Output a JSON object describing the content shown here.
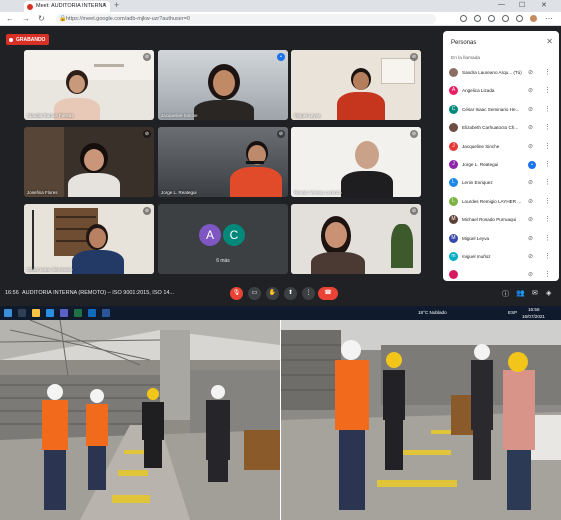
{
  "browser": {
    "tab_title": "Meet: AUDITORIA INTERNA",
    "url": "https://meet.google.com/adb-mjkw-uzr?authuser=0",
    "new_tab": "+",
    "minimize": "—",
    "maximize": "☐",
    "close": "✕"
  },
  "meet": {
    "recording_label": "GRABANDO",
    "time": "16:56",
    "meeting_title": "AUDITORIA INTERNA (REMOTO) – ISO 9001:2015, ISO 14...",
    "tiles": [
      {
        "label": "Claudia Ramos Fiestas",
        "mic": "muted"
      },
      {
        "label": "Jacqueline Sinche",
        "mic": "active"
      },
      {
        "label": "Miguel Leyva",
        "mic": "muted"
      },
      {
        "label": "Josefina Flores",
        "mic": "muted"
      },
      {
        "label": "Jorge L. Reategui",
        "mic": "muted"
      },
      {
        "label": "Renato Vereau Lorenzo",
        "mic": "muted"
      },
      {
        "label": "César Isaac Seminario",
        "mic": "muted"
      },
      {
        "label": "",
        "mic": ""
      },
      {
        "label": "",
        "mic": "muted"
      }
    ],
    "others": {
      "avatars": [
        "A",
        "C"
      ],
      "count_label": "6 más"
    }
  },
  "people_panel": {
    "title": "Personas",
    "close_icon": "✕",
    "section_label": "En la llamada",
    "participants": [
      {
        "name": "Sandra Laureano Arqu... (Tú)",
        "initial": "",
        "color": "#8d6e63",
        "mic": "muted"
      },
      {
        "name": "Angelica Lizada",
        "initial": "A",
        "color": "#e91e63",
        "mic": "muted"
      },
      {
        "name": "César Isaac Seminario He...",
        "initial": "C",
        "color": "#00897b",
        "mic": "muted"
      },
      {
        "name": "Elizabeth Carhuatocto Ch...",
        "initial": "",
        "color": "#6d4c41",
        "mic": "muted"
      },
      {
        "name": "Jacqueline Sinche",
        "initial": "J",
        "color": "#e53935",
        "mic": "muted"
      },
      {
        "name": "Jorge L. Reategui",
        "initial": "J",
        "color": "#8e24aa",
        "mic": "active"
      },
      {
        "name": "Lenin Enriquez",
        "initial": "L",
        "color": "#1e88e5",
        "mic": "muted"
      },
      {
        "name": "Lourdes Remigio LAYHER ...",
        "initial": "L",
        "color": "#7cb342",
        "mic": "muted"
      },
      {
        "name": "Michael Rosado Purruaqui",
        "initial": "M",
        "color": "#5d4037",
        "mic": "muted"
      },
      {
        "name": "Miguel Leyva",
        "initial": "M",
        "color": "#3949ab",
        "mic": "muted"
      },
      {
        "name": "miguel muñoz",
        "initial": "m",
        "color": "#00acc1",
        "mic": "muted"
      },
      {
        "name": "",
        "initial": "",
        "color": "#d81b60",
        "mic": "muted"
      }
    ]
  },
  "taskbar": {
    "weather": "18°C Nublado",
    "lang": "ESP",
    "time": "16:56",
    "date": "16/07/2021"
  }
}
